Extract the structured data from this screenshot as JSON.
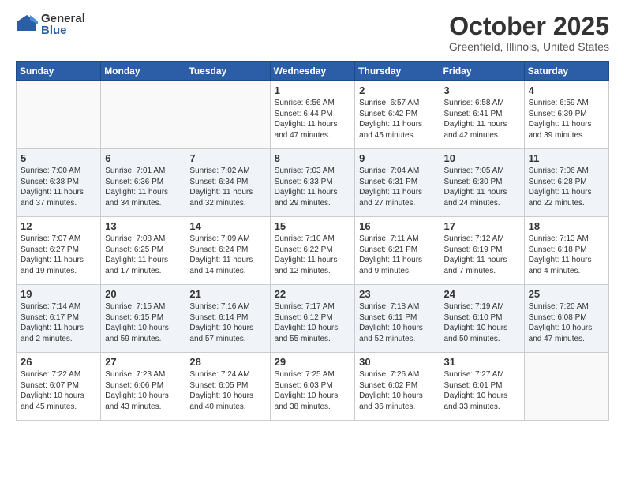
{
  "logo": {
    "general": "General",
    "blue": "Blue"
  },
  "title": "October 2025",
  "location": "Greenfield, Illinois, United States",
  "days_of_week": [
    "Sunday",
    "Monday",
    "Tuesday",
    "Wednesday",
    "Thursday",
    "Friday",
    "Saturday"
  ],
  "weeks": [
    [
      {
        "day": "",
        "content": ""
      },
      {
        "day": "",
        "content": ""
      },
      {
        "day": "",
        "content": ""
      },
      {
        "day": "1",
        "content": "Sunrise: 6:56 AM\nSunset: 6:44 PM\nDaylight: 11 hours and 47 minutes."
      },
      {
        "day": "2",
        "content": "Sunrise: 6:57 AM\nSunset: 6:42 PM\nDaylight: 11 hours and 45 minutes."
      },
      {
        "day": "3",
        "content": "Sunrise: 6:58 AM\nSunset: 6:41 PM\nDaylight: 11 hours and 42 minutes."
      },
      {
        "day": "4",
        "content": "Sunrise: 6:59 AM\nSunset: 6:39 PM\nDaylight: 11 hours and 39 minutes."
      }
    ],
    [
      {
        "day": "5",
        "content": "Sunrise: 7:00 AM\nSunset: 6:38 PM\nDaylight: 11 hours and 37 minutes."
      },
      {
        "day": "6",
        "content": "Sunrise: 7:01 AM\nSunset: 6:36 PM\nDaylight: 11 hours and 34 minutes."
      },
      {
        "day": "7",
        "content": "Sunrise: 7:02 AM\nSunset: 6:34 PM\nDaylight: 11 hours and 32 minutes."
      },
      {
        "day": "8",
        "content": "Sunrise: 7:03 AM\nSunset: 6:33 PM\nDaylight: 11 hours and 29 minutes."
      },
      {
        "day": "9",
        "content": "Sunrise: 7:04 AM\nSunset: 6:31 PM\nDaylight: 11 hours and 27 minutes."
      },
      {
        "day": "10",
        "content": "Sunrise: 7:05 AM\nSunset: 6:30 PM\nDaylight: 11 hours and 24 minutes."
      },
      {
        "day": "11",
        "content": "Sunrise: 7:06 AM\nSunset: 6:28 PM\nDaylight: 11 hours and 22 minutes."
      }
    ],
    [
      {
        "day": "12",
        "content": "Sunrise: 7:07 AM\nSunset: 6:27 PM\nDaylight: 11 hours and 19 minutes."
      },
      {
        "day": "13",
        "content": "Sunrise: 7:08 AM\nSunset: 6:25 PM\nDaylight: 11 hours and 17 minutes."
      },
      {
        "day": "14",
        "content": "Sunrise: 7:09 AM\nSunset: 6:24 PM\nDaylight: 11 hours and 14 minutes."
      },
      {
        "day": "15",
        "content": "Sunrise: 7:10 AM\nSunset: 6:22 PM\nDaylight: 11 hours and 12 minutes."
      },
      {
        "day": "16",
        "content": "Sunrise: 7:11 AM\nSunset: 6:21 PM\nDaylight: 11 hours and 9 minutes."
      },
      {
        "day": "17",
        "content": "Sunrise: 7:12 AM\nSunset: 6:19 PM\nDaylight: 11 hours and 7 minutes."
      },
      {
        "day": "18",
        "content": "Sunrise: 7:13 AM\nSunset: 6:18 PM\nDaylight: 11 hours and 4 minutes."
      }
    ],
    [
      {
        "day": "19",
        "content": "Sunrise: 7:14 AM\nSunset: 6:17 PM\nDaylight: 11 hours and 2 minutes."
      },
      {
        "day": "20",
        "content": "Sunrise: 7:15 AM\nSunset: 6:15 PM\nDaylight: 10 hours and 59 minutes."
      },
      {
        "day": "21",
        "content": "Sunrise: 7:16 AM\nSunset: 6:14 PM\nDaylight: 10 hours and 57 minutes."
      },
      {
        "day": "22",
        "content": "Sunrise: 7:17 AM\nSunset: 6:12 PM\nDaylight: 10 hours and 55 minutes."
      },
      {
        "day": "23",
        "content": "Sunrise: 7:18 AM\nSunset: 6:11 PM\nDaylight: 10 hours and 52 minutes."
      },
      {
        "day": "24",
        "content": "Sunrise: 7:19 AM\nSunset: 6:10 PM\nDaylight: 10 hours and 50 minutes."
      },
      {
        "day": "25",
        "content": "Sunrise: 7:20 AM\nSunset: 6:08 PM\nDaylight: 10 hours and 47 minutes."
      }
    ],
    [
      {
        "day": "26",
        "content": "Sunrise: 7:22 AM\nSunset: 6:07 PM\nDaylight: 10 hours and 45 minutes."
      },
      {
        "day": "27",
        "content": "Sunrise: 7:23 AM\nSunset: 6:06 PM\nDaylight: 10 hours and 43 minutes."
      },
      {
        "day": "28",
        "content": "Sunrise: 7:24 AM\nSunset: 6:05 PM\nDaylight: 10 hours and 40 minutes."
      },
      {
        "day": "29",
        "content": "Sunrise: 7:25 AM\nSunset: 6:03 PM\nDaylight: 10 hours and 38 minutes."
      },
      {
        "day": "30",
        "content": "Sunrise: 7:26 AM\nSunset: 6:02 PM\nDaylight: 10 hours and 36 minutes."
      },
      {
        "day": "31",
        "content": "Sunrise: 7:27 AM\nSunset: 6:01 PM\nDaylight: 10 hours and 33 minutes."
      },
      {
        "day": "",
        "content": ""
      }
    ]
  ]
}
